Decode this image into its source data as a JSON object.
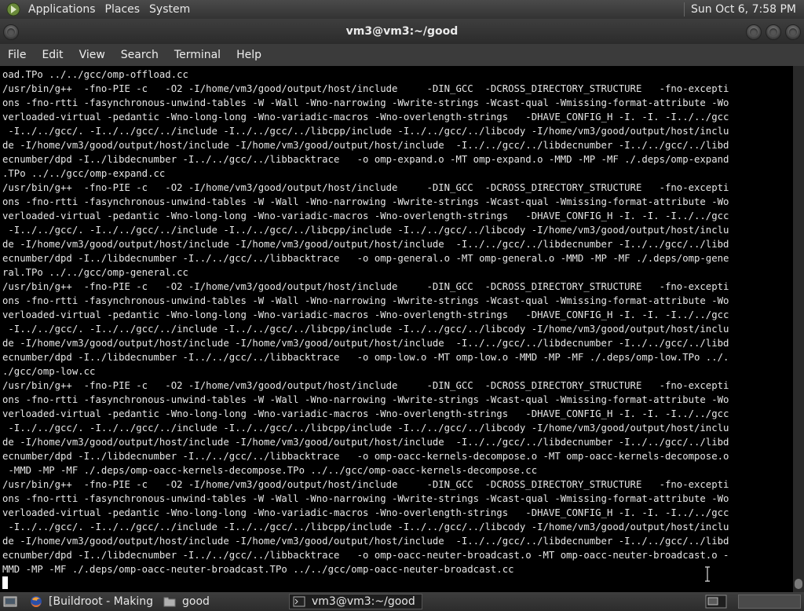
{
  "top_panel": {
    "menus": [
      "Applications",
      "Places",
      "System"
    ],
    "clock": "Sun Oct  6,  7:58 PM"
  },
  "window": {
    "title": "vm3@vm3:~/good"
  },
  "menubar": [
    "File",
    "Edit",
    "View",
    "Search",
    "Terminal",
    "Help"
  ],
  "terminal": {
    "lines": [
      "oad.TPo ../../gcc/omp-offload.cc",
      "/usr/bin/g++  -fno-PIE -c   -O2 -I/home/vm3/good/output/host/include     -DIN_GCC  -DCROSS_DIRECTORY_STRUCTURE   -fno-excepti",
      "ons -fno-rtti -fasynchronous-unwind-tables -W -Wall -Wno-narrowing -Wwrite-strings -Wcast-qual -Wmissing-format-attribute -Wo",
      "verloaded-virtual -pedantic -Wno-long-long -Wno-variadic-macros -Wno-overlength-strings   -DHAVE_CONFIG_H -I. -I. -I../../gcc",
      " -I../../gcc/. -I../../gcc/../include -I../../gcc/../libcpp/include -I../../gcc/../libcody -I/home/vm3/good/output/host/inclu",
      "de -I/home/vm3/good/output/host/include -I/home/vm3/good/output/host/include  -I../../gcc/../libdecnumber -I../../gcc/../libd",
      "ecnumber/dpd -I../libdecnumber -I../../gcc/../libbacktrace   -o omp-expand.o -MT omp-expand.o -MMD -MP -MF ./.deps/omp-expand",
      ".TPo ../../gcc/omp-expand.cc",
      "/usr/bin/g++  -fno-PIE -c   -O2 -I/home/vm3/good/output/host/include     -DIN_GCC  -DCROSS_DIRECTORY_STRUCTURE   -fno-excepti",
      "ons -fno-rtti -fasynchronous-unwind-tables -W -Wall -Wno-narrowing -Wwrite-strings -Wcast-qual -Wmissing-format-attribute -Wo",
      "verloaded-virtual -pedantic -Wno-long-long -Wno-variadic-macros -Wno-overlength-strings   -DHAVE_CONFIG_H -I. -I. -I../../gcc",
      " -I../../gcc/. -I../../gcc/../include -I../../gcc/../libcpp/include -I../../gcc/../libcody -I/home/vm3/good/output/host/inclu",
      "de -I/home/vm3/good/output/host/include -I/home/vm3/good/output/host/include  -I../../gcc/../libdecnumber -I../../gcc/../libd",
      "ecnumber/dpd -I../libdecnumber -I../../gcc/../libbacktrace   -o omp-general.o -MT omp-general.o -MMD -MP -MF ./.deps/omp-gene",
      "ral.TPo ../../gcc/omp-general.cc",
      "/usr/bin/g++  -fno-PIE -c   -O2 -I/home/vm3/good/output/host/include     -DIN_GCC  -DCROSS_DIRECTORY_STRUCTURE   -fno-excepti",
      "ons -fno-rtti -fasynchronous-unwind-tables -W -Wall -Wno-narrowing -Wwrite-strings -Wcast-qual -Wmissing-format-attribute -Wo",
      "verloaded-virtual -pedantic -Wno-long-long -Wno-variadic-macros -Wno-overlength-strings   -DHAVE_CONFIG_H -I. -I. -I../../gcc",
      " -I../../gcc/. -I../../gcc/../include -I../../gcc/../libcpp/include -I../../gcc/../libcody -I/home/vm3/good/output/host/inclu",
      "de -I/home/vm3/good/output/host/include -I/home/vm3/good/output/host/include  -I../../gcc/../libdecnumber -I../../gcc/../libd",
      "ecnumber/dpd -I../libdecnumber -I../../gcc/../libbacktrace   -o omp-low.o -MT omp-low.o -MMD -MP -MF ./.deps/omp-low.TPo ../.",
      "./gcc/omp-low.cc",
      "/usr/bin/g++  -fno-PIE -c   -O2 -I/home/vm3/good/output/host/include     -DIN_GCC  -DCROSS_DIRECTORY_STRUCTURE   -fno-excepti",
      "ons -fno-rtti -fasynchronous-unwind-tables -W -Wall -Wno-narrowing -Wwrite-strings -Wcast-qual -Wmissing-format-attribute -Wo",
      "verloaded-virtual -pedantic -Wno-long-long -Wno-variadic-macros -Wno-overlength-strings   -DHAVE_CONFIG_H -I. -I. -I../../gcc",
      " -I../../gcc/. -I../../gcc/../include -I../../gcc/../libcpp/include -I../../gcc/../libcody -I/home/vm3/good/output/host/inclu",
      "de -I/home/vm3/good/output/host/include -I/home/vm3/good/output/host/include  -I../../gcc/../libdecnumber -I../../gcc/../libd",
      "ecnumber/dpd -I../libdecnumber -I../../gcc/../libbacktrace   -o omp-oacc-kernels-decompose.o -MT omp-oacc-kernels-decompose.o",
      " -MMD -MP -MF ./.deps/omp-oacc-kernels-decompose.TPo ../../gcc/omp-oacc-kernels-decompose.cc",
      "/usr/bin/g++  -fno-PIE -c   -O2 -I/home/vm3/good/output/host/include     -DIN_GCC  -DCROSS_DIRECTORY_STRUCTURE   -fno-excepti",
      "ons -fno-rtti -fasynchronous-unwind-tables -W -Wall -Wno-narrowing -Wwrite-strings -Wcast-qual -Wmissing-format-attribute -Wo",
      "verloaded-virtual -pedantic -Wno-long-long -Wno-variadic-macros -Wno-overlength-strings   -DHAVE_CONFIG_H -I. -I. -I../../gcc",
      " -I../../gcc/. -I../../gcc/../include -I../../gcc/../libcpp/include -I../../gcc/../libcody -I/home/vm3/good/output/host/inclu",
      "de -I/home/vm3/good/output/host/include -I/home/vm3/good/output/host/include  -I../../gcc/../libdecnumber -I../../gcc/../libd",
      "ecnumber/dpd -I../libdecnumber -I../../gcc/../libbacktrace   -o omp-oacc-neuter-broadcast.o -MT omp-oacc-neuter-broadcast.o -",
      "MMD -MP -MF ./.deps/omp-oacc-neuter-broadcast.TPo ../../gcc/omp-oacc-neuter-broadcast.cc"
    ],
    "scroll_position": 1.0,
    "scroll_visible_fraction": 0.02
  },
  "taskbar": {
    "tasks": [
      {
        "label": "[Buildroot - Making ...",
        "icon": "firefox-icon",
        "active": false
      },
      {
        "label": "good",
        "icon": "folder-icon",
        "active": false
      },
      {
        "label": "vm3@vm3:~/good",
        "icon": "terminal-icon",
        "active": true
      }
    ]
  },
  "colors": {
    "terminal_bg": "#000000",
    "terminal_fg": "#e6e6e6",
    "panel_bg": "#3a3a3a",
    "titlebar_bg": "#333333"
  }
}
